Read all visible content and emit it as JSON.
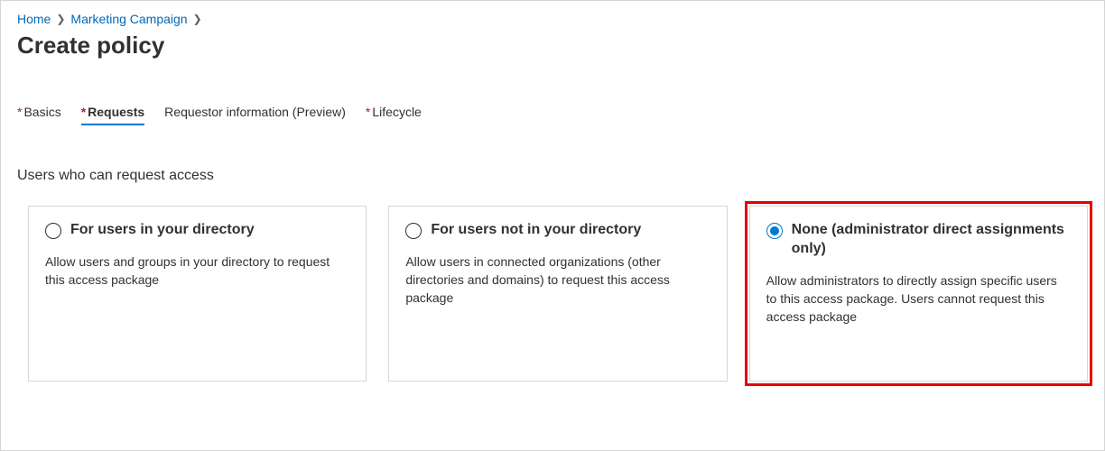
{
  "breadcrumb": {
    "home": "Home",
    "item1": "Marketing Campaign"
  },
  "page_title": "Create policy",
  "tabs": {
    "basics": "Basics",
    "requests": "Requests",
    "requestor_info": "Requestor information (Preview)",
    "lifecycle": "Lifecycle"
  },
  "section_heading": "Users who can request access",
  "options": {
    "opt1": {
      "title": "For users in your directory",
      "desc": "Allow users and groups in your directory to request this access package"
    },
    "opt2": {
      "title": "For users not in your directory",
      "desc": "Allow users in connected organizations (other directories and domains) to request this access package"
    },
    "opt3": {
      "title": "None (administrator direct assignments only)",
      "desc": "Allow administrators to directly assign specific users to this access package. Users cannot request this access package"
    }
  }
}
